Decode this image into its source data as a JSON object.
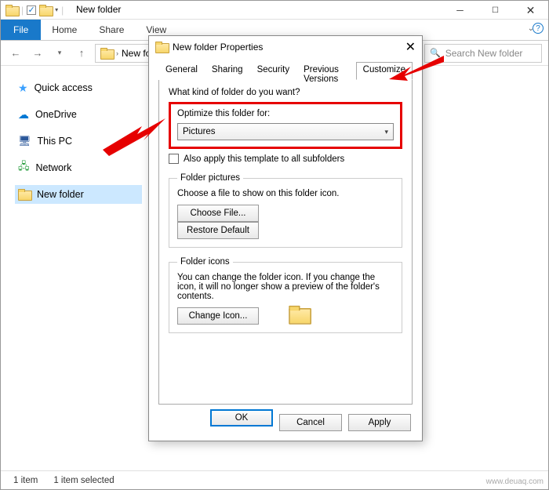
{
  "titlebar": {
    "title": "New folder"
  },
  "ribbon": {
    "file": "File",
    "tabs": [
      "Home",
      "Share",
      "View"
    ]
  },
  "navbar": {
    "breadcrumb": "New fol",
    "search_placeholder": "Search New folder"
  },
  "sidebar": {
    "items": [
      {
        "label": "Quick access"
      },
      {
        "label": "OneDrive"
      },
      {
        "label": "This PC"
      },
      {
        "label": "Network"
      },
      {
        "label": "New folder"
      }
    ]
  },
  "statusbar": {
    "count": "1 item",
    "selected": "1 item selected"
  },
  "dialog": {
    "title": "New folder Properties",
    "tabs": [
      "General",
      "Sharing",
      "Security",
      "Previous Versions",
      "Customize"
    ],
    "active_tab": "Customize",
    "question": "What kind of folder do you want?",
    "optimize_label": "Optimize this folder for:",
    "optimize_value": "Pictures",
    "apply_subfolders": "Also apply this template to all subfolders",
    "folder_pictures": {
      "legend": "Folder pictures",
      "text": "Choose a file to show on this folder icon.",
      "choose": "Choose File...",
      "restore": "Restore Default"
    },
    "folder_icons": {
      "legend": "Folder icons",
      "text": "You can change the folder icon. If you change the icon, it will no longer show a preview of the folder's contents.",
      "change": "Change Icon..."
    },
    "buttons": {
      "ok": "OK",
      "cancel": "Cancel",
      "apply": "Apply"
    }
  },
  "watermark": "www.deuaq.com"
}
